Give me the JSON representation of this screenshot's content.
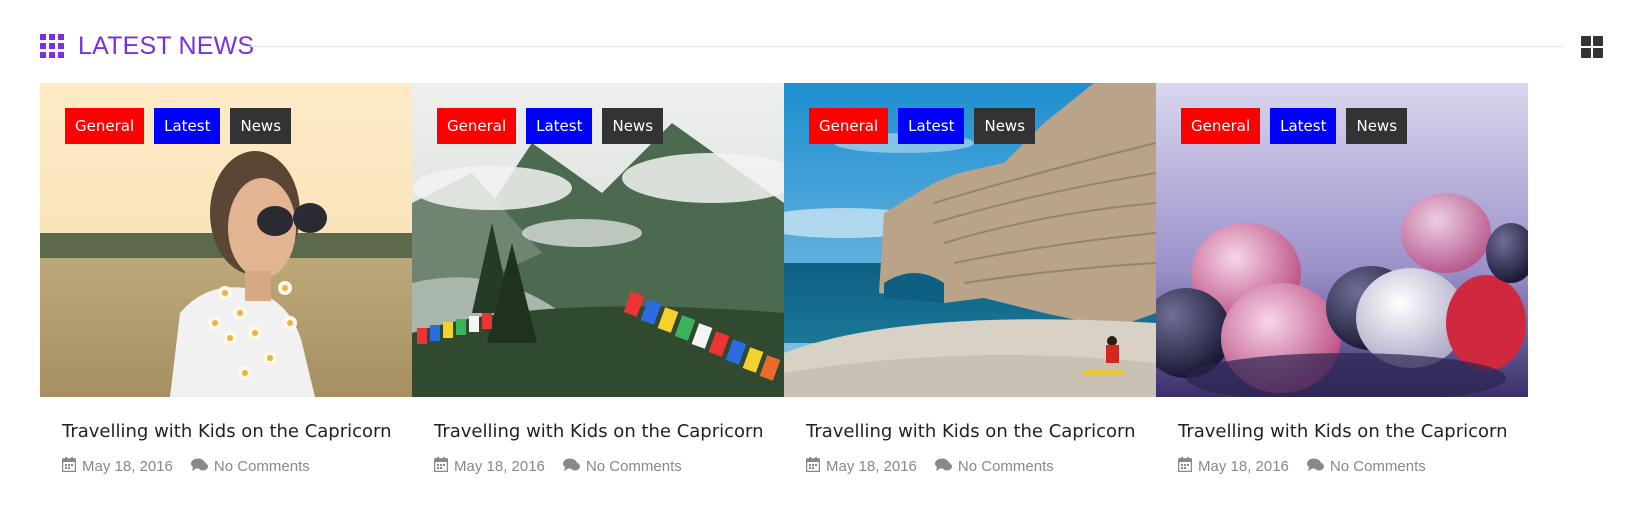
{
  "section": {
    "title": "LATEST NEWS",
    "icon": "grid-dots-icon",
    "view_icon": "grid-view-icon",
    "accent": "#7b2fe0"
  },
  "posts": [
    {
      "image": "woman-with-flowers-photo",
      "tags": [
        "General",
        "Latest",
        "News"
      ],
      "title": "Travelling with Kids on the Capricorn",
      "date": "May 18, 2016",
      "comments": "No Comments"
    },
    {
      "image": "mountain-prayer-flags-photo",
      "tags": [
        "General",
        "Latest",
        "News"
      ],
      "title": "Travelling with Kids on the Capricorn",
      "date": "May 18, 2016",
      "comments": "No Comments"
    },
    {
      "image": "cliff-beach-photo",
      "tags": [
        "General",
        "Latest",
        "News"
      ],
      "title": "Travelling with Kids on the Capricorn",
      "date": "May 18, 2016",
      "comments": "No Comments"
    },
    {
      "image": "frozen-berries-photo",
      "tags": [
        "General",
        "Latest",
        "News"
      ],
      "title": "Travelling with Kids on the Capricorn",
      "date": "May 18, 2016",
      "comments": "No Comments"
    }
  ],
  "tag_colors": {
    "general": "#ff0000",
    "latest": "#0000ff",
    "news": "#333333"
  }
}
